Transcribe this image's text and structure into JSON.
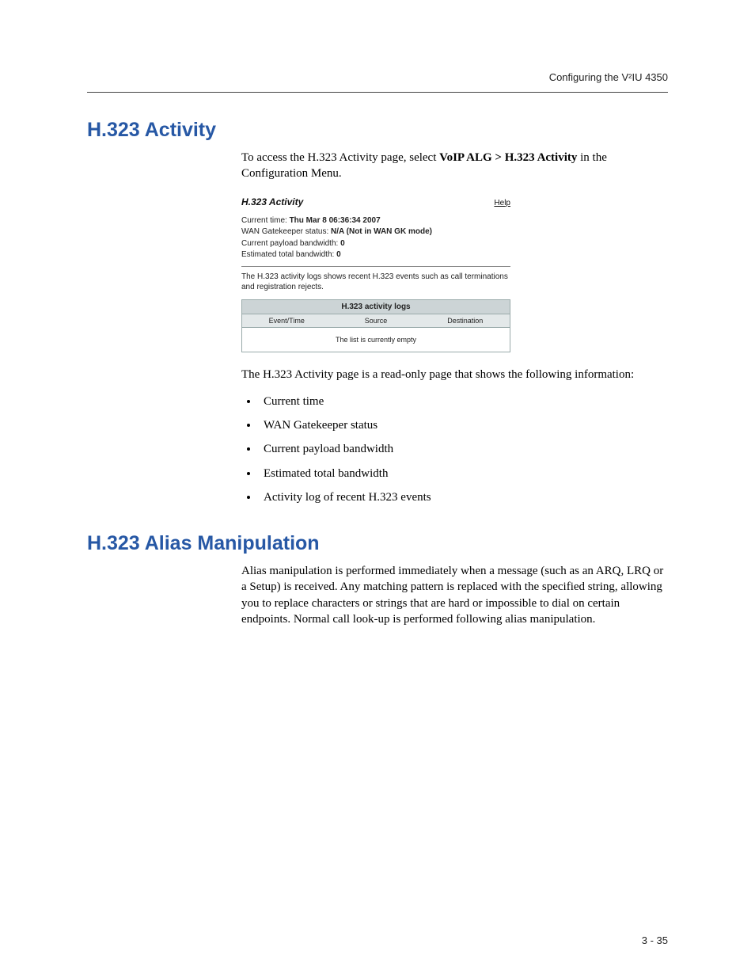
{
  "header": {
    "running_title": "Configuring the V²IU 4350"
  },
  "section1": {
    "heading": "H.323 Activity",
    "intro_pre": "To access the H.323 Activity page, select ",
    "intro_bold": "VoIP ALG > H.323 Activity",
    "intro_post": " in the Configuration Menu."
  },
  "embed": {
    "title": "H.323 Activity",
    "help": "Help",
    "stats": {
      "line1_label": "Current time: ",
      "line1_value": "Thu Mar 8 06:36:34 2007",
      "line2_label": "WAN Gatekeeper status: ",
      "line2_value": "N/A (Not in WAN GK mode)",
      "line3_label": "Current payload bandwidth: ",
      "line3_value": "0",
      "line4_label": "Estimated total bandwidth: ",
      "line4_value": "0"
    },
    "desc": "The H.323 activity logs shows recent H.323 events such as call terminations and registration rejects.",
    "table": {
      "caption": "H.323 activity logs",
      "col1": "Event/Time",
      "col2": "Source",
      "col3": "Destination",
      "empty_msg": "The list is currently empty"
    }
  },
  "section1b": {
    "followup": "The H.323 Activity page is a read-only page that shows the following information:",
    "bullets": [
      "Current time",
      "WAN Gatekeeper status",
      "Current payload bandwidth",
      "Estimated total bandwidth",
      "Activity log of recent H.323 events"
    ]
  },
  "section2": {
    "heading": "H.323 Alias Manipulation",
    "para": "Alias manipulation is performed immediately when a message (such as an ARQ, LRQ or a Setup) is received. Any matching pattern is replaced with the specified string, allowing you to replace characters or strings that are hard or impossible to dial on certain endpoints. Normal call look-up is performed following alias manipulation."
  },
  "footer": {
    "page_number": "3 - 35"
  }
}
